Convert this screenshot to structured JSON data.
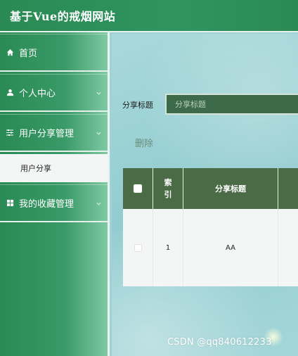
{
  "header": {
    "title": "基于Vue的戒烟网站"
  },
  "sidebar": {
    "items": [
      {
        "label": "首页",
        "icon": "home-icon"
      },
      {
        "label": "个人中心",
        "icon": "user-icon"
      },
      {
        "label": "用户分享管理",
        "icon": "sliders-icon"
      },
      {
        "label": "我的收藏管理",
        "icon": "grid-icon"
      }
    ],
    "submenu": {
      "label": "用户分享"
    }
  },
  "search": {
    "label": "分享标题",
    "placeholder": "分享标题"
  },
  "toolbar": {
    "delete_label": "删除"
  },
  "table": {
    "headers": [
      "索引",
      "分享标题"
    ],
    "rows": [
      {
        "index": "1",
        "title": "AA"
      }
    ]
  },
  "watermark": "CSDN @qq840612233",
  "colors": {
    "header": "#2a8a54",
    "table_header": "#4b6a46",
    "input_bg": "#3d6b4a"
  }
}
